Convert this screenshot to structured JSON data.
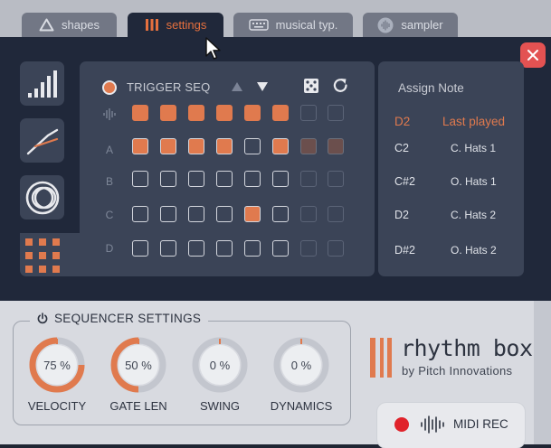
{
  "tabs": [
    {
      "label": "shapes",
      "icon": "triangle-icon",
      "active": false
    },
    {
      "label": "settings",
      "icon": "bars-icon",
      "active": true
    },
    {
      "label": "musical typ.",
      "icon": "keyboard-icon",
      "active": false
    },
    {
      "label": "sampler",
      "icon": "waveform-circle-icon",
      "active": false
    }
  ],
  "sequencer": {
    "title": "TRIGGER SEQ",
    "row_labels": [
      "",
      "A",
      "B",
      "C",
      "D"
    ],
    "grid": [
      [
        1,
        1,
        1,
        1,
        1,
        1,
        0,
        0
      ],
      [
        1,
        1,
        1,
        1,
        0,
        1,
        1,
        1
      ],
      [
        0,
        0,
        0,
        0,
        0,
        0,
        0,
        0
      ],
      [
        0,
        0,
        0,
        0,
        1,
        0,
        0,
        0
      ],
      [
        0,
        0,
        0,
        0,
        0,
        0,
        0,
        0
      ]
    ],
    "active_steps": 6,
    "total_steps": 8
  },
  "assign": {
    "title": "Assign Note",
    "header_note": "D2",
    "header_sample": "Last played",
    "rows": [
      {
        "note": "C2",
        "sample": "C. Hats 1"
      },
      {
        "note": "C#2",
        "sample": "O. Hats 1"
      },
      {
        "note": "D2",
        "sample": "C. Hats 2"
      },
      {
        "note": "D#2",
        "sample": "O. Hats 2"
      }
    ]
  },
  "settings": {
    "title": "SEQUENCER SETTINGS",
    "knobs": [
      {
        "label": "VELOCITY",
        "value": "75 %",
        "fraction": 0.75
      },
      {
        "label": "GATE LEN",
        "value": "50 %",
        "fraction": 0.5
      },
      {
        "label": "SWING",
        "value": "0 %",
        "fraction": 0
      },
      {
        "label": "DYNAMICS",
        "value": "0 %",
        "fraction": 0
      }
    ]
  },
  "brand": {
    "name": "rhythm box",
    "byline": "by Pitch Innovations"
  },
  "midi": {
    "label": "MIDI REC"
  },
  "colors": {
    "accent": "#e07a4e",
    "panel": "#3b4457",
    "background": "#20283a",
    "close": "#e35252",
    "record": "#e0222a"
  }
}
